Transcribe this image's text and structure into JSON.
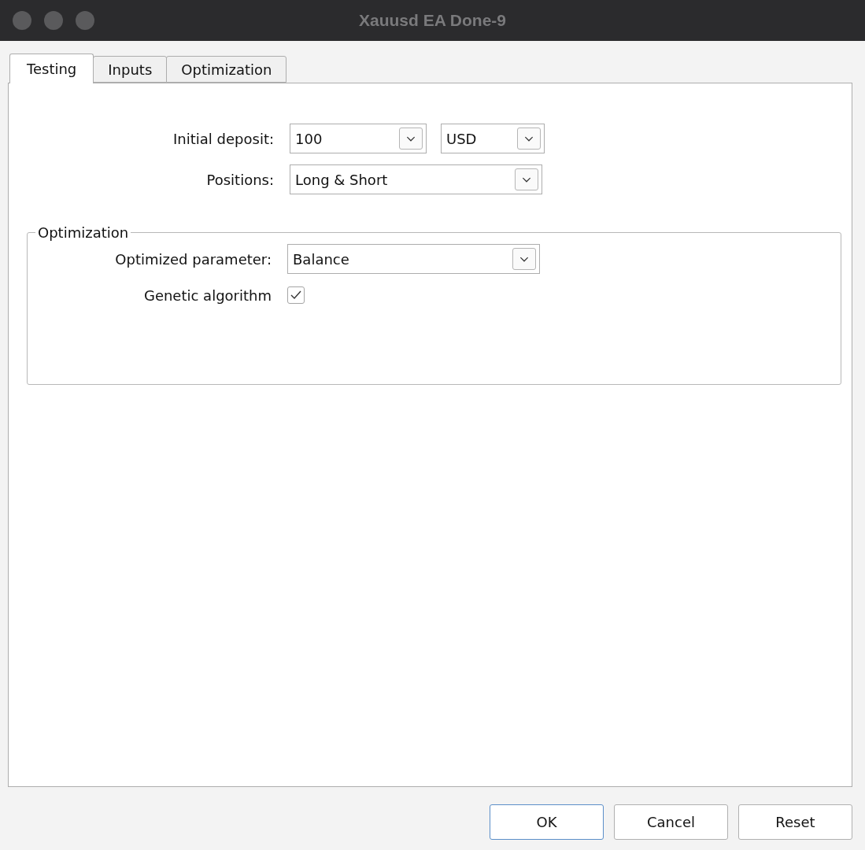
{
  "window": {
    "title": "Xauusd EA Done-9"
  },
  "tabs": [
    {
      "label": "Testing",
      "selected": true
    },
    {
      "label": "Inputs",
      "selected": false
    },
    {
      "label": "Optimization",
      "selected": false
    }
  ],
  "settings": [
    {
      "label": "Initial deposit:",
      "kind": "combos",
      "values": [
        "100",
        "USD"
      ]
    },
    {
      "label": "Positions:",
      "kind": "combo",
      "value": "Long & Short"
    }
  ],
  "optimization_group": {
    "title": "Optimization",
    "rows": [
      {
        "label": "Optimized parameter:",
        "kind": "combo",
        "value": "Balance"
      },
      {
        "label": "Genetic algorithm",
        "kind": "checkbox",
        "checked": true
      }
    ]
  },
  "buttons": [
    {
      "label": "OK",
      "default": true
    },
    {
      "label": "Cancel",
      "default": false
    },
    {
      "label": "Reset",
      "default": false
    }
  ]
}
